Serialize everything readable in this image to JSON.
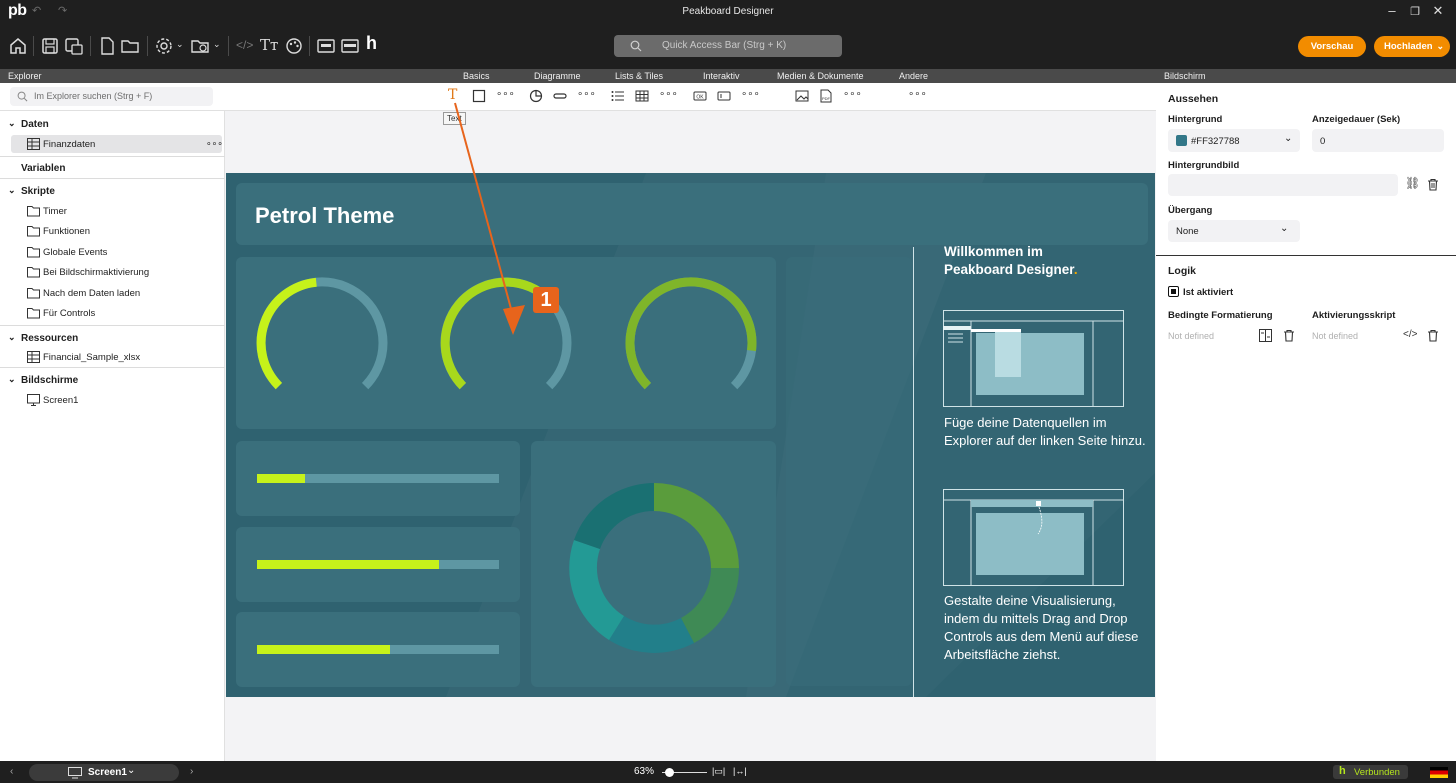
{
  "titlebar": {
    "logo": "pb",
    "title": "Peakboard Designer"
  },
  "toolbar": {
    "quick_access_placeholder": "Quick Access Bar (Strg + K)",
    "preview_label": "Vorschau",
    "upload_label": "Hochladen"
  },
  "sections": {
    "explorer": "Explorer",
    "basics": "Basics",
    "charts": "Diagramme",
    "lists": "Lists & Tiles",
    "interactive": "Interaktiv",
    "media": "Medien & Dokumente",
    "other": "Andere",
    "screen": "Bildschirm"
  },
  "palette": {
    "tooltip": "Text"
  },
  "explorer": {
    "search_placeholder": "Im Explorer suchen (Strg + F)",
    "data": {
      "label": "Daten",
      "items": [
        "Finanzdaten"
      ]
    },
    "variables": {
      "label": "Variablen"
    },
    "scripts": {
      "label": "Skripte",
      "items": [
        "Timer",
        "Funktionen",
        "Globale Events",
        "Bei Bildschirmaktivierung",
        "Nach dem Daten laden",
        "Für Controls"
      ]
    },
    "resources": {
      "label": "Ressourcen",
      "items": [
        "Financial_Sample_xlsx"
      ]
    },
    "screens": {
      "label": "Bildschirme",
      "items": [
        "Screen1"
      ]
    }
  },
  "canvas": {
    "title": "Petrol Theme",
    "welcome_heading_1": "Willkommen im",
    "welcome_heading_2": "Peakboard Designer",
    "welcome_dot": ".",
    "step1_line1": "Füge deine Datenquellen im",
    "step1_line2": "Explorer auf der linken Seite hinzu.",
    "step2_line1": "Gestalte deine Visualisierung,",
    "step2_line2": "indem du mittels Drag and Drop",
    "step2_line3": "Controls aus dem Menü auf diese",
    "step2_line4": "Arbeitsfläche ziehst.",
    "gauges": [
      0.48,
      0.62,
      0.86
    ],
    "progress": [
      0.2,
      0.75,
      0.55
    ]
  },
  "annotation": {
    "badge": "1"
  },
  "properties": {
    "appearance": "Aussehen",
    "background_label": "Hintergrund",
    "background_value": "#FF327788",
    "background_color": "#327788",
    "duration_label": "Anzeigedauer (Sek)",
    "duration_value": "0",
    "bg_image_label": "Hintergrundbild",
    "transition_label": "Übergang",
    "transition_value": "None",
    "logic": "Logik",
    "is_active": "Ist aktiviert",
    "cond_format_label": "Bedingte Formatierung",
    "cond_format_value": "Not defined",
    "activation_script_label": "Aktivierungsskript",
    "activation_script_value": "Not defined"
  },
  "statusbar": {
    "screen": "Screen1",
    "zoom": "63%",
    "connected": "Verbunden"
  },
  "colors": {
    "accent": "#f28c00",
    "petrol": "#2f6270",
    "tile": "#3a6f7c",
    "lime": "#c6f21a"
  }
}
